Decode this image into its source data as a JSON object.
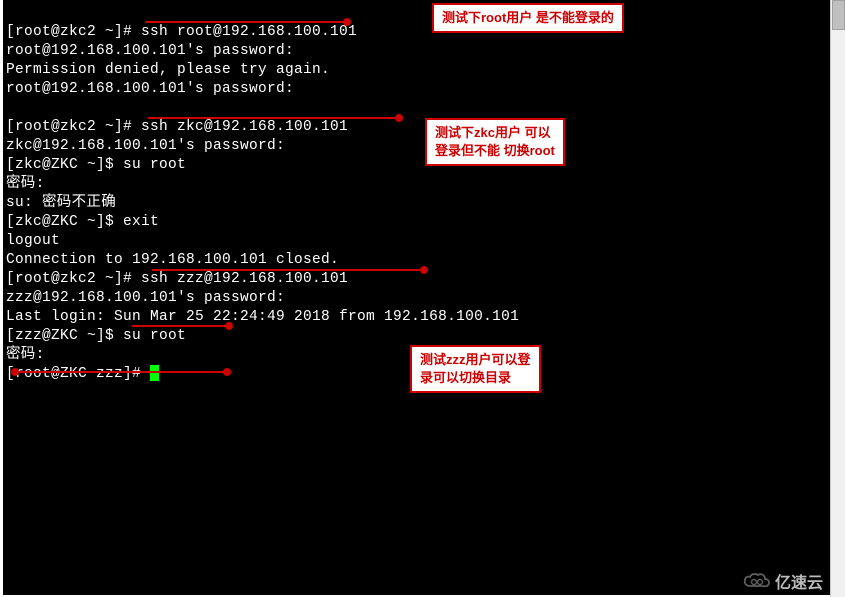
{
  "terminal": {
    "lines": [
      "[root@zkc2 ~]# ssh root@192.168.100.101",
      "root@192.168.100.101's password:",
      "Permission denied, please try again.",
      "root@192.168.100.101's password:",
      "",
      "[root@zkc2 ~]# ssh zkc@192.168.100.101",
      "zkc@192.168.100.101's password:",
      "[zkc@ZKC ~]$ su root",
      "密码:",
      "su: 密码不正确",
      "[zkc@ZKC ~]$ exit",
      "logout",
      "Connection to 192.168.100.101 closed.",
      "[root@zkc2 ~]# ssh zzz@192.168.100.101",
      "zzz@192.168.100.101's password:",
      "Last login: Sun Mar 25 22:24:49 2018 from 192.168.100.101",
      "[zzz@ZKC ~]$ su root",
      "密码:",
      "[root@ZKC zzz]# "
    ]
  },
  "annotations": {
    "a1": "测试下root用户 是不能登录的",
    "a2_line1": "测试下zkc用户 可以",
    "a2_line2": "登录但不能 切换root",
    "a3_line1": "测试zzz用户可以登",
    "a3_line2": "录可以切换目录"
  },
  "watermark": {
    "text": "亿速云"
  }
}
